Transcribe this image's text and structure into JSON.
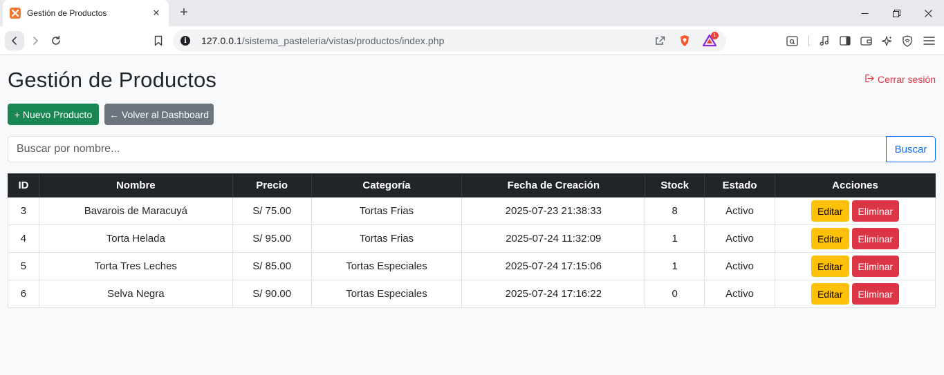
{
  "browser": {
    "tab_title": "Gestión de Productos",
    "tab_close": "✕",
    "new_tab": "+",
    "url_host": "127.0.0.1",
    "url_path": "/sistema_pasteleria/vistas/productos/index.php",
    "info_glyph": "i",
    "extension_badge": "1"
  },
  "page": {
    "title": "Gestión de Productos",
    "logout_label": "Cerrar sesión",
    "new_product_label": "+ Nuevo Producto",
    "back_label": "← Volver al Dashboard",
    "search_placeholder": "Buscar por nombre...",
    "search_button": "Buscar"
  },
  "table": {
    "headers": [
      "ID",
      "Nombre",
      "Precio",
      "Categoría",
      "Fecha de Creación",
      "Stock",
      "Estado",
      "Acciones"
    ],
    "edit_label": "Editar",
    "delete_label": "Eliminar",
    "rows": [
      [
        "3",
        "Bavarois de Maracuyá",
        "S/ 75.00",
        "Tortas Frias",
        "2025-07-23 21:38:33",
        "8",
        "Activo"
      ],
      [
        "4",
        "Torta Helada",
        "S/ 95.00",
        "Tortas Frias",
        "2025-07-24 11:32:09",
        "1",
        "Activo"
      ],
      [
        "5",
        "Torta Tres Leches",
        "S/ 85.00",
        "Tortas Especiales",
        "2025-07-24 17:15:06",
        "1",
        "Activo"
      ],
      [
        "6",
        "Selva Negra",
        "S/ 90.00",
        "Tortas Especiales",
        "2025-07-24 17:16:22",
        "0",
        "Activo"
      ]
    ]
  },
  "colors": {
    "success": "#198754",
    "secondary": "#6c757d",
    "warning": "#ffc107",
    "danger": "#dc3545",
    "primary": "#0d6efd",
    "dark": "#212529"
  }
}
